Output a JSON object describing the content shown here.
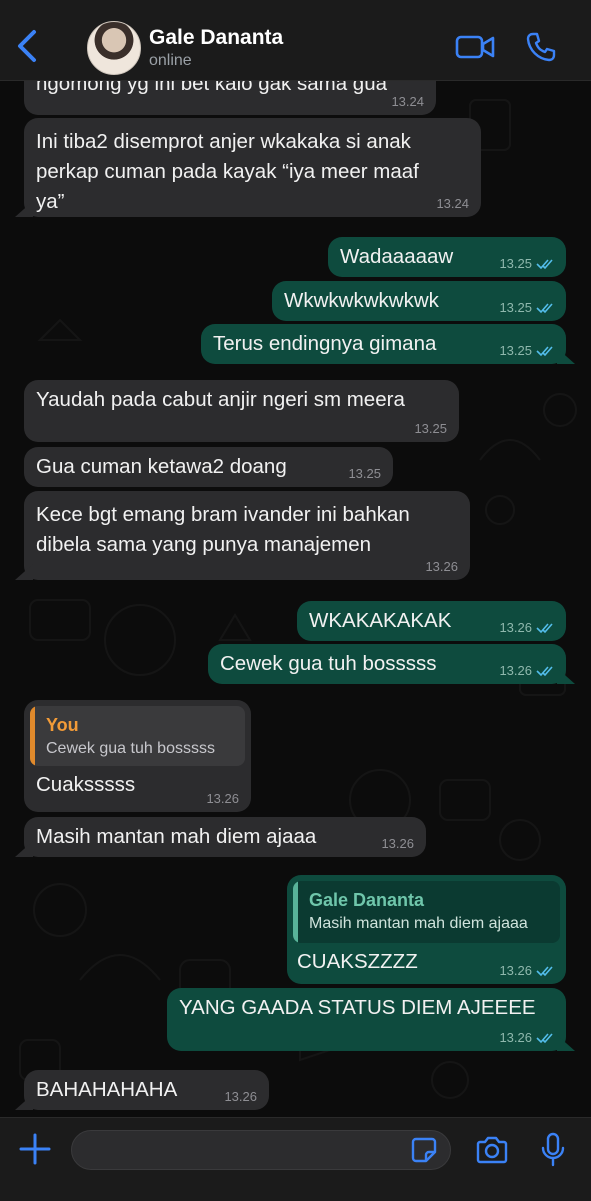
{
  "header": {
    "contact_name": "Gale Dananta",
    "status": "online"
  },
  "colors": {
    "accent": "#3b82f6",
    "incoming_bubble": "#2c2c2e",
    "outgoing_bubble": "#0e4b3e",
    "read_ticks": "#53bdeb",
    "quote_you": "#f29b38",
    "quote_contact": "#6fc6ab"
  },
  "messages": [
    {
      "text": "ngomong yg ini bet kalo gak sama gua",
      "time": "13.24"
    },
    {
      "text": "Ini tiba2 disemprot anjer wkakaka si anak\nperkap cuman pada kayak “iya meer maaf\nya”",
      "time": "13.24"
    },
    {
      "text": "Wadaaaaaw",
      "time": "13.25"
    },
    {
      "text": "Wkwkwkwkwkwk",
      "time": "13.25"
    },
    {
      "text": "Terus endingnya gimana",
      "time": "13.25"
    },
    {
      "text": "Yaudah pada cabut anjir ngeri sm meera",
      "time": "13.25"
    },
    {
      "text": "Gua cuman ketawa2 doang",
      "time": "13.25"
    },
    {
      "text": "Kece bgt emang bram ivander ini bahkan\ndibela sama yang punya manajemen",
      "time": "13.26"
    },
    {
      "text": "WKAKAKAKAK",
      "time": "13.26"
    },
    {
      "text": "Cewek gua tuh bosssss",
      "time": "13.26"
    },
    {
      "quote_author": "You",
      "quote_text": "Cewek gua tuh bosssss",
      "text": "Cuaksssss",
      "time": "13.26"
    },
    {
      "text": "Masih mantan mah diem ajaaa",
      "time": "13.26"
    },
    {
      "quote_author": "Gale Dananta",
      "quote_text": "Masih mantan mah diem ajaaa",
      "text": "CUAKSZZZZ",
      "time": "13.26"
    },
    {
      "text": "YANG GAADA STATUS DIEM AJEEEE",
      "time": "13.26"
    },
    {
      "text": "BAHAHAHAHA",
      "time": "13.26"
    }
  ],
  "input": {
    "value": "",
    "placeholder": ""
  }
}
